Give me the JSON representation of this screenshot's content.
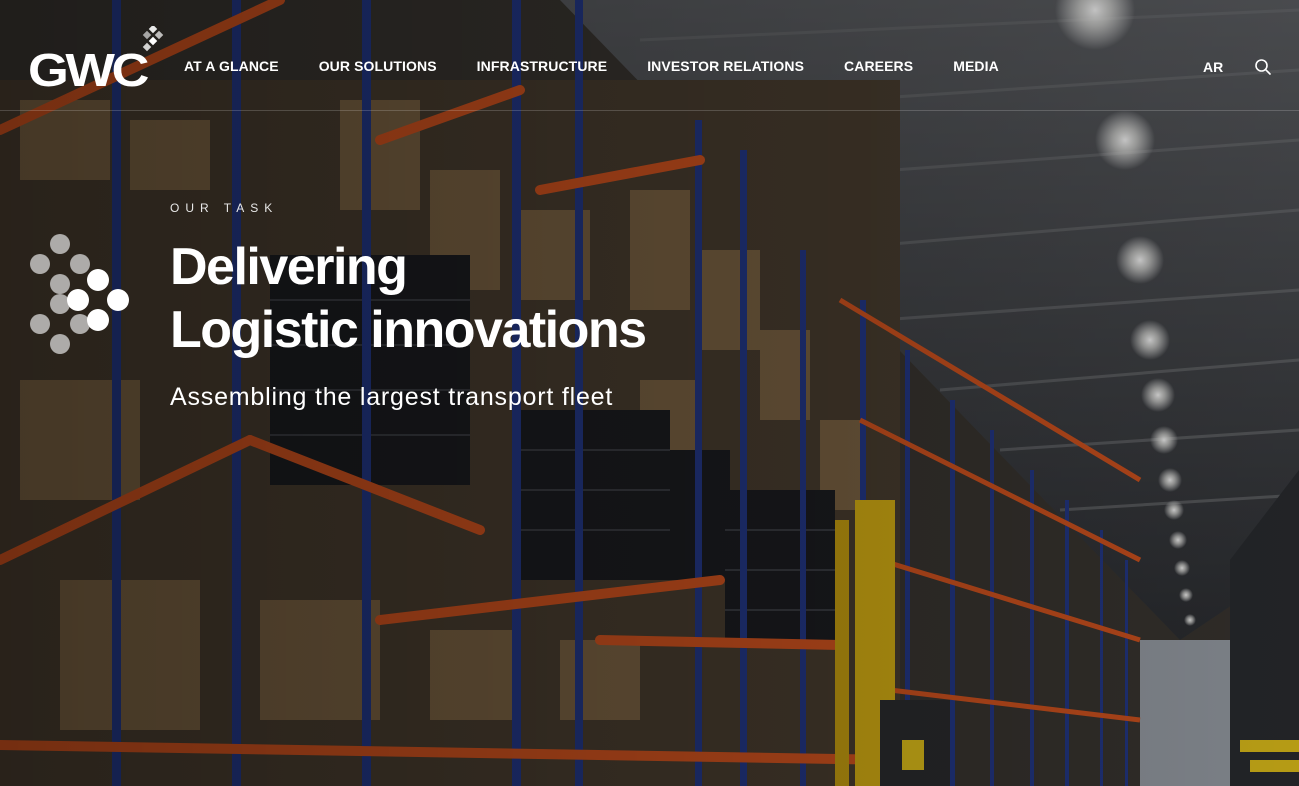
{
  "brand": {
    "logo_text": "GWC"
  },
  "nav": {
    "items": [
      {
        "label": "AT A GLANCE"
      },
      {
        "label": "OUR SOLUTIONS"
      },
      {
        "label": "INFRASTRUCTURE"
      },
      {
        "label": "INVESTOR RELATIONS"
      },
      {
        "label": "CAREERS"
      },
      {
        "label": "MEDIA"
      }
    ],
    "language": "AR",
    "search_icon": "search-icon"
  },
  "hero": {
    "eyebrow": "OUR TASK",
    "title_line1": "Delivering",
    "title_line2": "Logistic innovations",
    "subtitle": "Assembling the largest transport fleet",
    "background": "warehouse-photo"
  },
  "colors": {
    "text": "#ffffff",
    "rack_orange": "#d4541f",
    "rack_blue": "#24398a",
    "forklift_yellow": "#d9b114"
  }
}
